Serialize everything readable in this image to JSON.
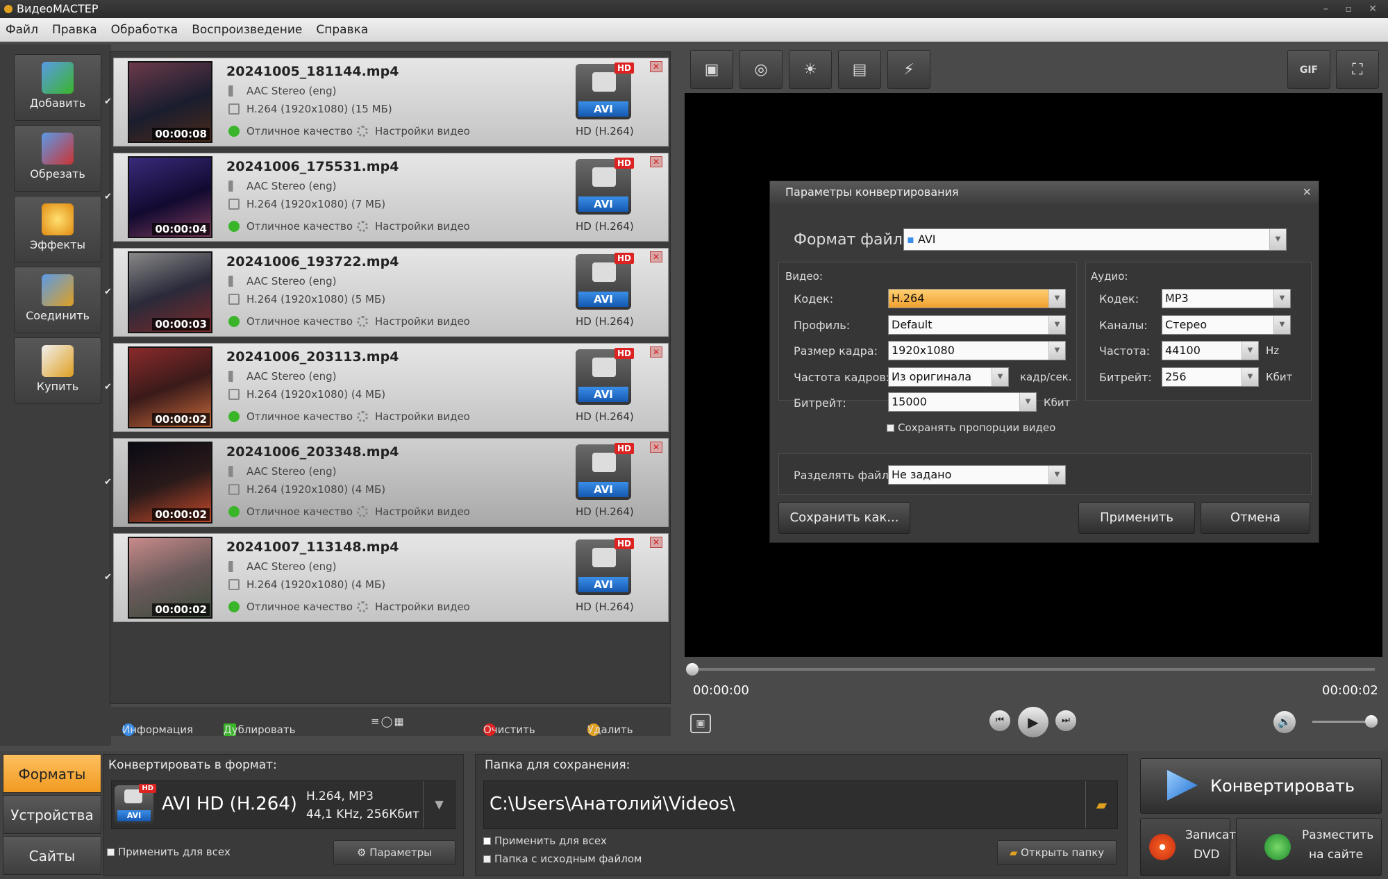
{
  "app": {
    "title": "ВидеоМАСТЕР"
  },
  "menu": [
    "Файл",
    "Правка",
    "Обработка",
    "Воспроизведение",
    "Справка"
  ],
  "tools": [
    "Добавить",
    "Обрезать",
    "Эффекты",
    "Соединить",
    "Купить"
  ],
  "files": [
    {
      "name": "20241005_181144.mp4",
      "audio": "AAC Stereo (eng)",
      "video": "H.264 (1920x1080) (15 МБ)",
      "quality": "Отличное качество",
      "settings": "Настройки видео",
      "duration": "00:00:08",
      "badge_hd": "HD",
      "badge_fmt": "AVI",
      "format": "HD (H.264)",
      "checked": true
    },
    {
      "name": "20241006_175531.mp4",
      "audio": "AAC Stereo (eng)",
      "video": "H.264 (1920x1080) (7 МБ)",
      "quality": "Отличное качество",
      "settings": "Настройки видео",
      "duration": "00:00:04",
      "badge_hd": "HD",
      "badge_fmt": "AVI",
      "format": "HD (H.264)",
      "checked": true
    },
    {
      "name": "20241006_193722.mp4",
      "audio": "AAC Stereo (eng)",
      "video": "H.264 (1920x1080) (5 МБ)",
      "quality": "Отличное качество",
      "settings": "Настройки видео",
      "duration": "00:00:03",
      "badge_hd": "HD",
      "badge_fmt": "AVI",
      "format": "HD (H.264)",
      "checked": true
    },
    {
      "name": "20241006_203113.mp4",
      "audio": "AAC Stereo (eng)",
      "video": "H.264 (1920x1080) (4 МБ)",
      "quality": "Отличное качество",
      "settings": "Настройки видео",
      "duration": "00:00:02",
      "badge_hd": "HD",
      "badge_fmt": "AVI",
      "format": "HD (H.264)",
      "checked": true
    },
    {
      "name": "20241006_203348.mp4",
      "audio": "AAC Stereo (eng)",
      "video": "H.264 (1920x1080) (4 МБ)",
      "quality": "Отличное качество",
      "settings": "Настройки видео",
      "duration": "00:00:02",
      "badge_hd": "HD",
      "badge_fmt": "AVI",
      "format": "HD (H.264)",
      "checked": true
    },
    {
      "name": "20241007_113148.mp4",
      "audio": "AAC Stereo (eng)",
      "video": "H.264 (1920x1080) (4 МБ)",
      "quality": "Отличное качество",
      "settings": "Настройки видео",
      "duration": "00:00:02",
      "badge_hd": "HD",
      "badge_fmt": "AVI",
      "format": "HD (H.264)",
      "checked": true
    }
  ],
  "list_footer": {
    "info": "Информация",
    "duplicate": "Дублировать",
    "clear": "Очистить",
    "delete": "Удалить"
  },
  "preview_tools": {
    "gif": "GIF"
  },
  "player": {
    "current": "00:00:00",
    "total": "00:00:02",
    "progress": 0,
    "volume": 1.0
  },
  "dialog": {
    "title": "Параметры конвертирования",
    "format_label": "Формат файла:",
    "format_value": "AVI",
    "video_group": "Видео:",
    "audio_group": "Аудио:",
    "v_codec_label": "Кодек:",
    "v_codec": "H.264",
    "profile_label": "Профиль:",
    "profile": "Default",
    "size_label": "Размер кадра:",
    "size": "1920x1080",
    "fps_label": "Частота кадров:",
    "fps": "Из оригинала",
    "fps_unit": "кадр/сек.",
    "v_bitrate_label": "Битрейт:",
    "v_bitrate": "15000",
    "v_bitrate_unit": "Кбит",
    "keep_ratio": "Сохранять пропорции видео",
    "a_codec_label": "Кодек:",
    "a_codec": "MP3",
    "channels_label": "Каналы:",
    "channels": "Стерео",
    "freq_label": "Частота:",
    "freq": "44100",
    "freq_unit": "Hz",
    "a_bitrate_label": "Битрейт:",
    "a_bitrate": "256",
    "a_bitrate_unit": "Кбит",
    "split_label": "Разделять файл:",
    "split": "Не задано",
    "save_as": "Сохранить как...",
    "apply": "Применить",
    "cancel": "Отмена"
  },
  "bottom": {
    "tabs": [
      "Форматы",
      "Устройства",
      "Сайты"
    ],
    "convert_to_label": "Конвертировать в формат:",
    "format_name": "AVI HD (H.264)",
    "format_badge_hd": "HD",
    "format_badge_fmt": "AVI",
    "format_detail1": "H.264, MP3",
    "format_detail2": "44,1 KHz, 256Кбит",
    "apply_all": "Применить для всех",
    "params": "Параметры",
    "folder_label": "Папка для сохранения:",
    "folder_path": "C:\\Users\\Анатолий\\Videos\\",
    "apply_all2": "Применить для всех",
    "source_folder": "Папка с исходным файлом",
    "open_folder": "Открыть папку",
    "convert": "Конвертировать",
    "burn_dvd_1": "Записать",
    "burn_dvd_2": "DVD",
    "publish_1": "Разместить",
    "publish_2": "на сайте"
  },
  "colors": {
    "accent": "#f0a030",
    "avi_badge": "#1f6ed0",
    "hd_badge": "#d22222",
    "quality_ok": "#3ab52a"
  }
}
